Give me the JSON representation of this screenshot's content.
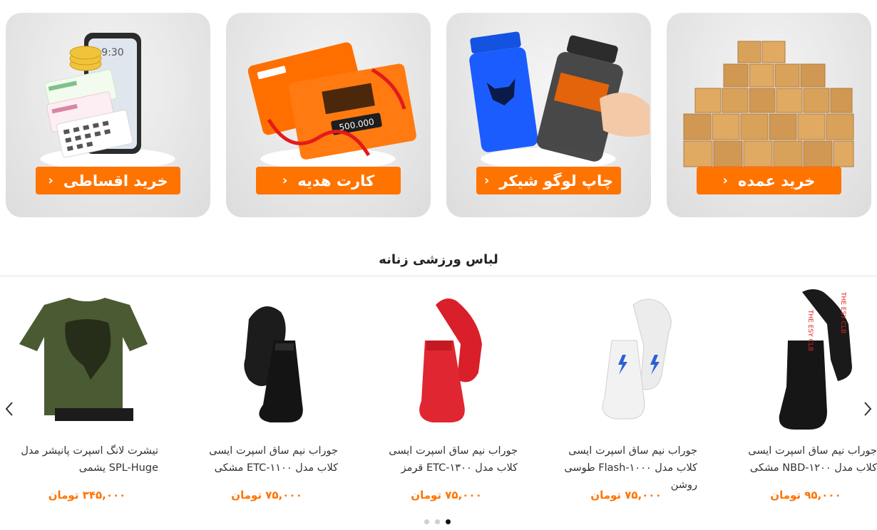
{
  "banners": [
    {
      "label": "خرید اقساطی",
      "icon": "installment-phone-calendar-art"
    },
    {
      "label": "کارت هدیه",
      "icon": "gift-card-art",
      "card_amount": "500.000"
    },
    {
      "label": "چاپ لوگو شیکر",
      "icon": "shaker-bottles-art"
    },
    {
      "label": "خرید عمده",
      "icon": "cardboard-boxes-art"
    }
  ],
  "banner_chevron": "‹",
  "section": {
    "title": "لباس ورزشی زنانه"
  },
  "products": [
    {
      "name": "جوراب نیم ساق اسپرت ایسی کلاب مدل NBD-۱۲۰۰ مشکی",
      "price": "۹۵,۰۰۰ تومان",
      "icon": "black-red-socks-image"
    },
    {
      "name": "جوراب نیم ساق اسپرت ایسی کلاب مدل Flash-۱۰۰۰ طوسی روشن",
      "price": "۷۵,۰۰۰ تومان",
      "icon": "white-flash-socks-image"
    },
    {
      "name": "جوراب نیم ساق اسپرت ایسی کلاب مدل ETC-۱۳۰۰ قرمز",
      "price": "۷۵,۰۰۰ تومان",
      "icon": "red-socks-image"
    },
    {
      "name": "جوراب نیم ساق اسپرت ایسی کلاب مدل ETC-۱۱۰۰ مشکی",
      "price": "۷۵,۰۰۰ تومان",
      "icon": "black-socks-image"
    },
    {
      "name": "تیشرت لانگ اسپرت پانیشر مدل SPL-Huge یشمی",
      "price": "۳۴۵,۰۰۰ تومان",
      "icon": "green-punisher-tshirt-image"
    }
  ],
  "carousel": {
    "prev_icon": "chevron-left-icon",
    "next_icon": "chevron-right-icon",
    "page_count": 3,
    "active_page": 1
  },
  "colors": {
    "accent": "#ff7300",
    "banner_bg": "#e6e6e6",
    "text": "#333333"
  }
}
